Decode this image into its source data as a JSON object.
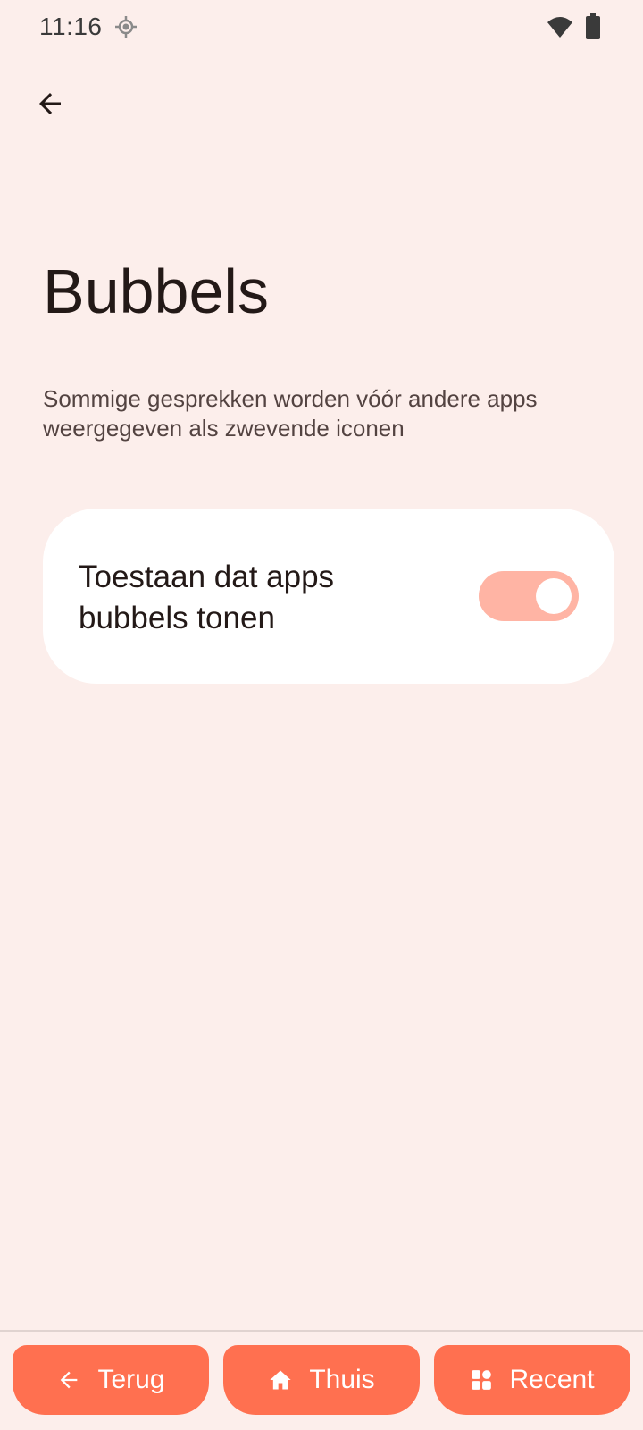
{
  "status_bar": {
    "time": "11:16",
    "icons": [
      "location-icon",
      "wifi-icon",
      "battery-icon"
    ]
  },
  "header": {
    "back_icon": "arrow-left-icon"
  },
  "page": {
    "title": "Bubbels",
    "description": "Sommige gesprekken worden vóór andere apps weergegeven als zwevende iconen"
  },
  "setting": {
    "label": "Toestaan dat apps bubbels tonen",
    "enabled": true
  },
  "nav_bar": {
    "back_label": "Terug",
    "home_label": "Thuis",
    "recent_label": "Recent"
  },
  "colors": {
    "background": "#FCEEEB",
    "card": "#FFFFFF",
    "toggle_track": "#FFB4A4",
    "nav_button": "#FF7050",
    "text_primary": "#231917",
    "text_secondary": "#534341"
  }
}
